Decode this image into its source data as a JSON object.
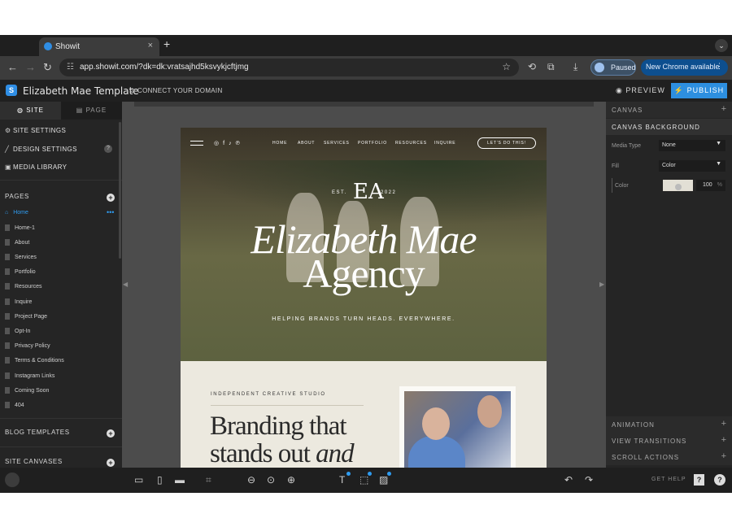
{
  "browser": {
    "tab_title": "Showit",
    "tab_close": "×",
    "new_tab": "+",
    "tab_menu": "⌄",
    "url": "app.showit.com/?dk=dk:vratsajhd5ksvykjcftjmg",
    "paused_label": "Paused",
    "new_chrome_label": "New Chrome available",
    "kebab": "⋮"
  },
  "app": {
    "title": "Elizabeth Mae Template",
    "connect_domain": "CONNECT YOUR DOMAIN",
    "preview_label": "PREVIEW",
    "publish_label": "PUBLISH"
  },
  "left_panel": {
    "tabs": {
      "site": "SITE",
      "page": "PAGE"
    },
    "menu": [
      {
        "label": "SITE SETTINGS",
        "icon": "gear-icon"
      },
      {
        "label": "DESIGN SETTINGS",
        "icon": "brush-icon"
      },
      {
        "label": "MEDIA LIBRARY",
        "icon": "image-icon"
      }
    ],
    "help": "?",
    "pages_header": "PAGES",
    "pages": [
      "Home",
      "Home-1",
      "About",
      "Services",
      "Portfolio",
      "Resources",
      "Inquire",
      "Project Page",
      "Opt-In",
      "Privacy Policy",
      "Terms & Conditions",
      "Instagram Links",
      "Coming Soon",
      "404"
    ],
    "active_page_dots": "•••",
    "blog_templates_header": "BLOG TEMPLATES",
    "site_canvases_header": "SITE CANVASES"
  },
  "site_preview": {
    "nav_links": [
      "HOME",
      "ABOUT",
      "SERVICES",
      "PORTFOLIO",
      "RESOURCES",
      "INQUIRE"
    ],
    "cta": "LET'S DO THIS!",
    "est_label": "EST.",
    "year": "2022",
    "monogram": "EA",
    "hero_line1": "Elizabeth Mae",
    "hero_line2": "Agency",
    "tagline": "HELPING BRANDS TURN HEADS. EVERYWHERE.",
    "section_kicker": "INDEPENDENT CREATIVE STUDIO",
    "section_line1": "Branding that",
    "section_line2_a": "stands out ",
    "section_line2_b": "and"
  },
  "right_panel": {
    "canvas_header": "CANVAS",
    "canvas_bg_header": "CANVAS BACKGROUND",
    "media_type_label": "Media Type",
    "media_type_value": "None",
    "fill_label": "Fill",
    "fill_value": "Color",
    "color_label": "Color",
    "opacity_value": "100",
    "opacity_unit": "%",
    "animation_header": "ANIMATION",
    "view_transitions_header": "VIEW TRANSITIONS",
    "scroll_actions_header": "SCROLL ACTIONS",
    "plus": "+"
  },
  "bottom_bar": {
    "get_help": "GET HELP",
    "help_square": "?",
    "help_circle": "?"
  },
  "colors": {
    "accent": "#2d8fe0",
    "canvas_bg_swatch": "#e2dfd5"
  }
}
